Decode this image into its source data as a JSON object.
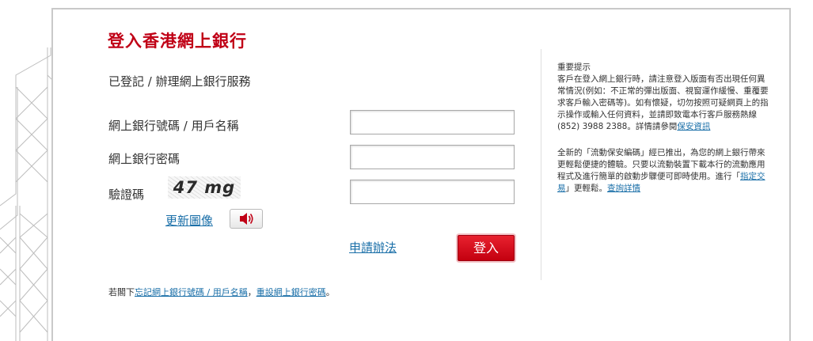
{
  "page_title": "登入香港網上銀行",
  "subtitle": "已登記 / 辦理網上銀行服務",
  "form": {
    "username_label": "網上銀行號碼 / 用戶名稱",
    "password_label": "網上銀行密碼",
    "captcha_label": "驗證碼",
    "captcha_text": "47 mg",
    "refresh_label": "更新圖像",
    "apply_label": "申請辦法",
    "login_label": "登入"
  },
  "forgot": {
    "prefix": "若閣下",
    "forgot_username": "忘記網上銀行號碼 / 用戶名稱",
    "sep": "，",
    "reset_password": "重設網上銀行密碼",
    "suffix": "。"
  },
  "notice": {
    "heading": "重要提示",
    "para1_text": "客戶在登入網上銀行時，請注意登入版面有否出現任何異常情況(例如：不正常的彈出版面、視窗運作緩慢、重覆要求客戶輸入密碼等)。如有懷疑，切勿按照可疑網頁上的指示操作或輸入任何資料，並請即致電本行客戶服務熱線(852) 3988 2388。詳情請參閱",
    "para1_link": "保安資訊",
    "para2_text1": "全新的「流動保安編碼」經已推出，為您的網上銀行帶來更輕鬆便捷的體驗。只要以流動裝置下載本行的流動應用程式及進行簡單的啟動步驟便可即時使用。進行「",
    "para2_link1": "指定交易",
    "para2_text2": "」更輕鬆。",
    "para2_link2": "查詢詳情"
  },
  "colors": {
    "brand_red": "#c00016",
    "link_blue": "#1a6fa8"
  },
  "icons": {
    "audio": "speaker-icon"
  }
}
